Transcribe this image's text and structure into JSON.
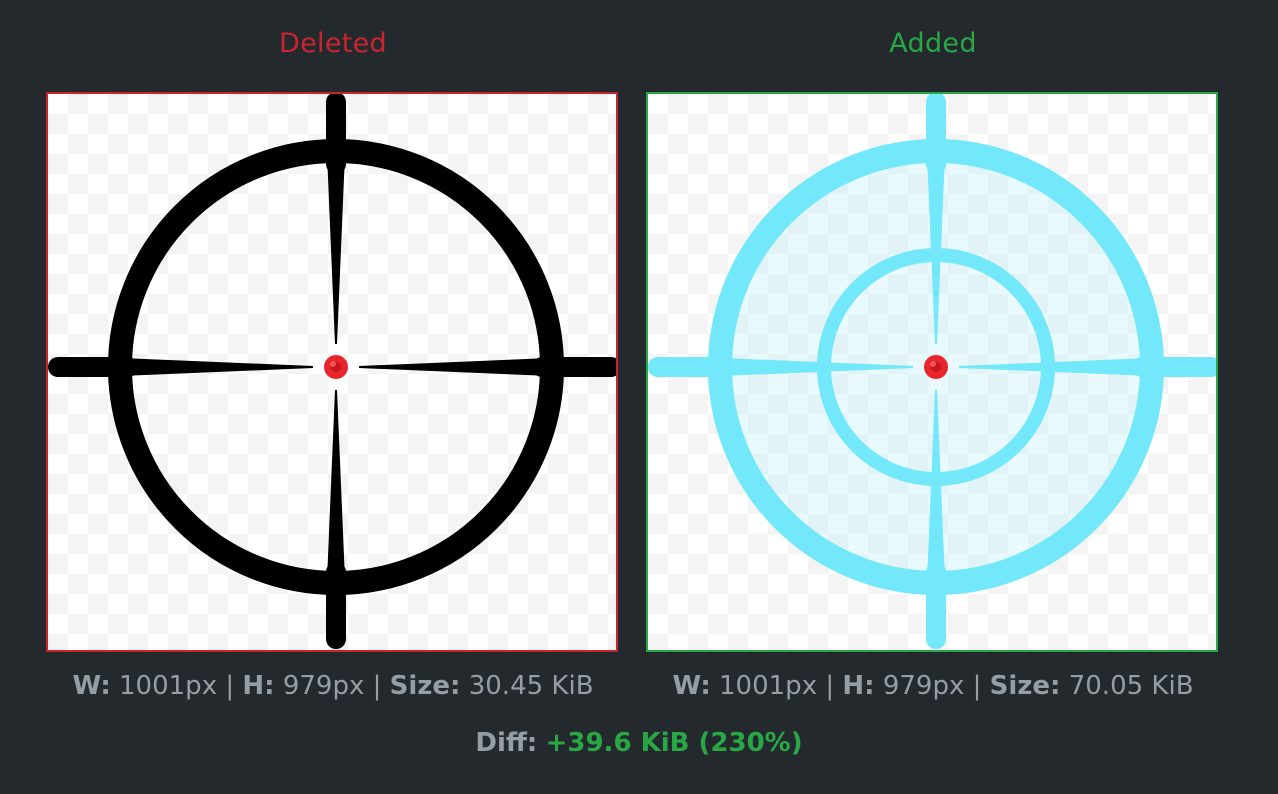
{
  "deleted": {
    "title": "Deleted",
    "w_label": "W:",
    "w_value": "1001px",
    "h_label": "H:",
    "h_value": "979px",
    "size_label": "Size:",
    "size_value": "30.45 KiB",
    "border_color": "#cb2431",
    "crosshair_color": "#000000",
    "dot_color": "#e8242c"
  },
  "added": {
    "title": "Added",
    "w_label": "W:",
    "w_value": "1001px",
    "h_label": "H:",
    "h_value": "979px",
    "size_label": "Size:",
    "size_value": "70.05 KiB",
    "border_color": "#28a745",
    "crosshair_color": "#72e8fa",
    "dot_color": "#e8242c"
  },
  "separator": "|",
  "diff": {
    "label": "Diff:",
    "value": "+39.6 KiB (230%)"
  },
  "icons": {
    "deleted_image": "crosshair-black-icon",
    "added_image": "crosshair-cyan-icon"
  }
}
